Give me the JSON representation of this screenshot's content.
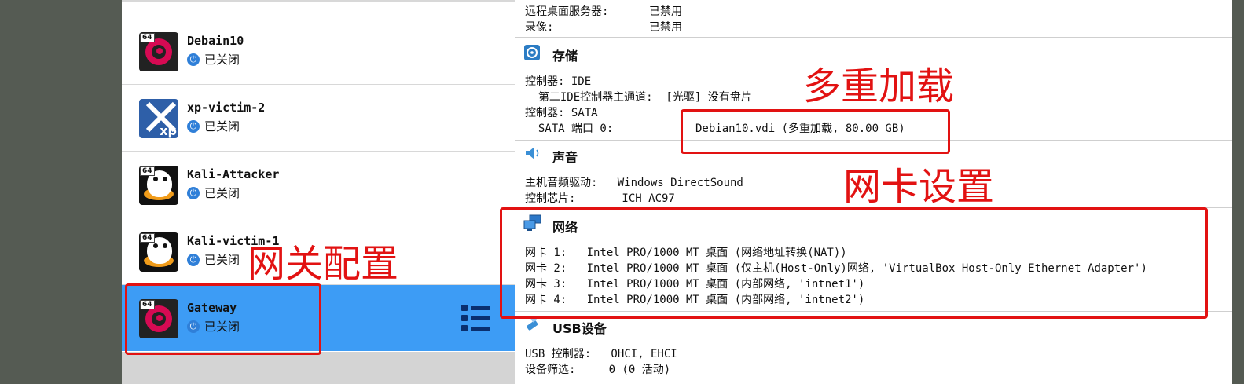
{
  "vm_list": {
    "items": [
      {
        "name": "Debain10",
        "status": "已关闭",
        "os": "debian"
      },
      {
        "name": "xp-victim-2",
        "status": "已关闭",
        "os": "xp"
      },
      {
        "name": "Kali-Attacker",
        "status": "已关闭",
        "os": "kali"
      },
      {
        "name": "Kali-victim-1",
        "status": "已关闭",
        "os": "kali"
      },
      {
        "name": "Gateway",
        "status": "已关闭",
        "os": "debian",
        "selected": true
      }
    ],
    "badge": "64",
    "xp_label": "xp"
  },
  "details": {
    "display": {
      "rows": [
        {
          "label": "远程桌面服务器:",
          "value": "已禁用"
        },
        {
          "label": "录像:",
          "value": "已禁用"
        }
      ]
    },
    "storage": {
      "title": "存储",
      "lines": [
        "控制器: IDE",
        "  第二IDE控制器主通道:  [光驱] 没有盘片",
        "控制器: SATA",
        "  SATA 端口 0:"
      ],
      "disk": "Debian10.vdi (多重加载, 80.00 GB)"
    },
    "audio": {
      "title": "声音",
      "lines": [
        "主机音频驱动:   Windows DirectSound",
        "控制芯片:       ICH AC97"
      ]
    },
    "network": {
      "title": "网络",
      "lines": [
        "网卡 1:   Intel PRO/1000 MT 桌面 (网络地址转换(NAT))",
        "网卡 2:   Intel PRO/1000 MT 桌面 (仅主机(Host-Only)网络, 'VirtualBox Host-Only Ethernet Adapter')",
        "网卡 3:   Intel PRO/1000 MT 桌面 (内部网络, 'intnet1')",
        "网卡 4:   Intel PRO/1000 MT 桌面 (内部网络, 'intnet2')"
      ]
    },
    "usb": {
      "title": "USB设备",
      "lines": [
        "USB 控制器:   OHCI, EHCI",
        "设备筛选:     0 (0 活动)"
      ]
    }
  },
  "annotations": {
    "gateway": "网关配置",
    "multiload": "多重加载",
    "nic": "网卡设置"
  },
  "colors": {
    "selected_bg": "#3d9cf5",
    "annotation_red": "#e21212",
    "background": "#545a52"
  }
}
